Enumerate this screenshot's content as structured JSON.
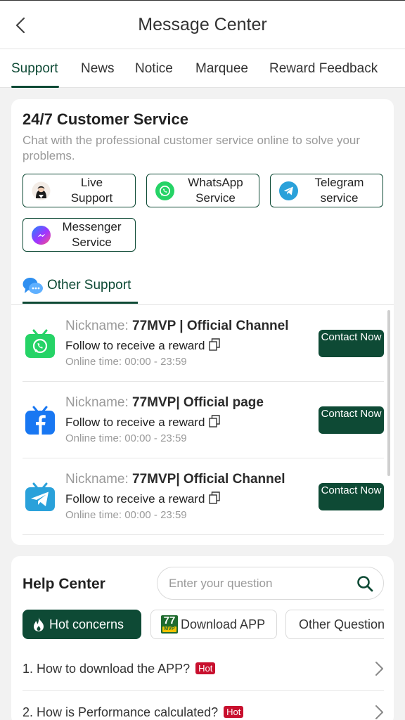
{
  "header": {
    "title": "Message Center"
  },
  "tabs": [
    {
      "label": "Support"
    },
    {
      "label": "News"
    },
    {
      "label": "Notice"
    },
    {
      "label": "Marquee"
    },
    {
      "label": "Reward Feedback"
    }
  ],
  "service": {
    "title": "24/7 Customer Service",
    "subtitle": "Chat with the professional customer service online to solve your problems.",
    "buttons": [
      {
        "line1": "Live",
        "line2": "Support",
        "icon": "agent-avatar-icon"
      },
      {
        "line1": "WhatsApp",
        "line2": "Service",
        "icon": "whatsapp-icon"
      },
      {
        "line1": "Telegram",
        "line2": "service",
        "icon": "telegram-icon"
      },
      {
        "line1": "Messenger",
        "line2": "Service",
        "icon": "messenger-icon"
      }
    ],
    "other_support_label": "Other Support"
  },
  "channels": [
    {
      "nick_label": "Nickname:",
      "nick_value": "77MVP | Official Channel",
      "follow": "Follow to receive a reward",
      "online_label": "Online time:",
      "online_value": "00:00 - 23:59",
      "button": "Contact Now",
      "icon": "whatsapp-tv-icon"
    },
    {
      "nick_label": "Nickname:",
      "nick_value": "77MVP| Official page",
      "follow": "Follow to receive a reward",
      "online_label": "Online time:",
      "online_value": "00:00 - 23:59",
      "button": "Contact Now",
      "icon": "facebook-tv-icon"
    },
    {
      "nick_label": "Nickname:",
      "nick_value": "77MVP| Official Channel",
      "follow": "Follow to receive a reward",
      "online_label": "Online time:",
      "online_value": "00:00 - 23:59",
      "button": "Contact Now",
      "icon": "telegram-tv-icon"
    }
  ],
  "help": {
    "title": "Help Center",
    "search_placeholder": "Enter your question",
    "chips": [
      {
        "label": "Hot concerns",
        "icon": "flame-icon"
      },
      {
        "label": "Download APP",
        "icon": "77mvp-logo-icon",
        "logo_text": "77",
        "logo_sub": "MVP"
      },
      {
        "label": "Other Questions",
        "icon": "question-circle-icon"
      }
    ],
    "faqs": [
      {
        "text": "1. How to download the APP?",
        "badge": "Hot"
      },
      {
        "text": "2. How is Performance calculated?",
        "badge": "Hot"
      }
    ]
  },
  "colors": {
    "primary": "#0e4a35",
    "hot": "#c8102e",
    "whatsapp": "#25d366",
    "telegram": "#2aa1da",
    "facebook": "#1877f2"
  }
}
